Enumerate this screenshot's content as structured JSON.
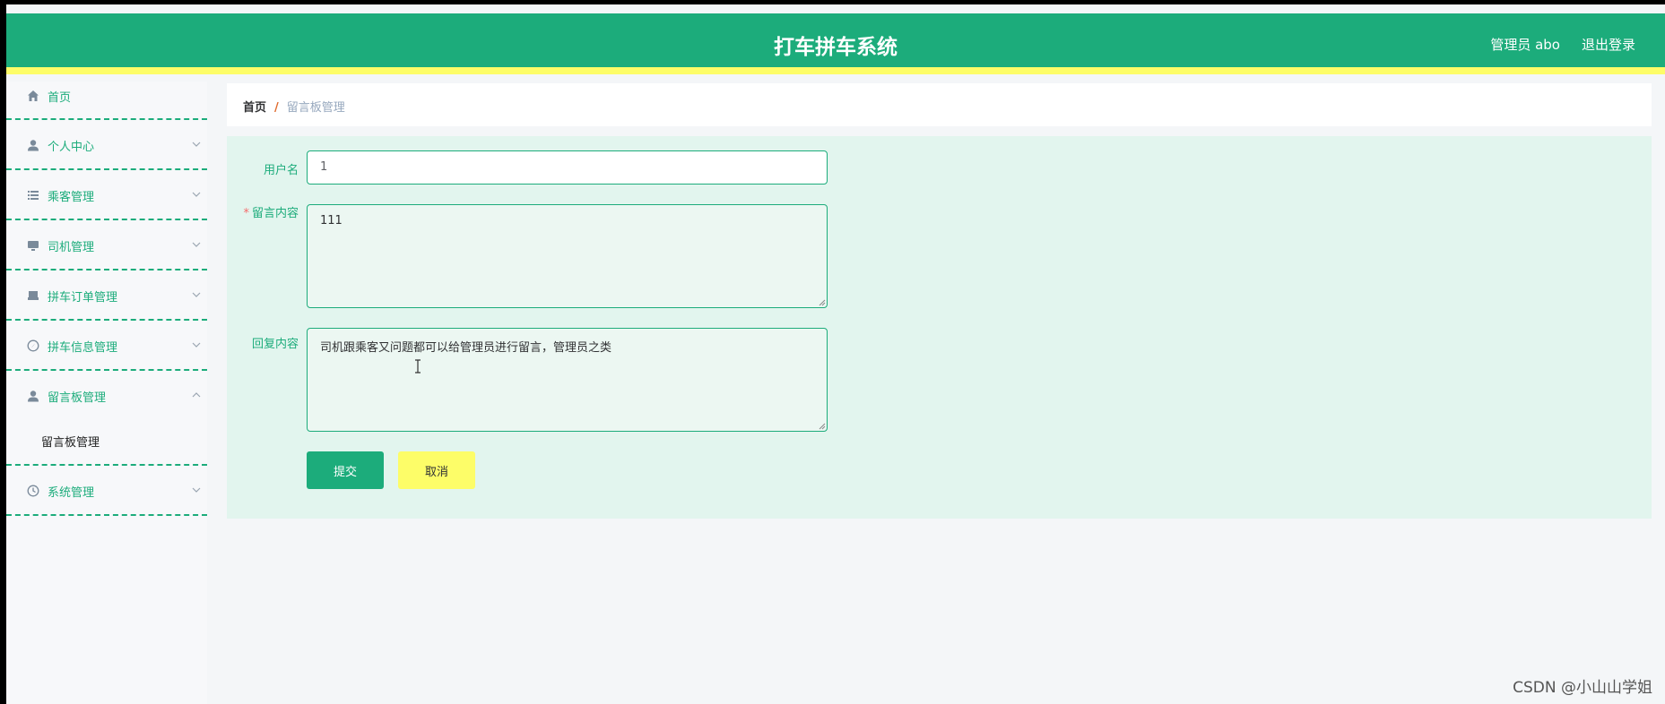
{
  "header": {
    "title": "打车拼车系统",
    "user": "管理员 abo",
    "logout": "退出登录"
  },
  "sidebar": {
    "items": [
      {
        "label": "首页",
        "icon": "home-icon"
      },
      {
        "label": "个人中心",
        "icon": "user-icon"
      },
      {
        "label": "乘客管理",
        "icon": "list-icon"
      },
      {
        "label": "司机管理",
        "icon": "monitor-icon"
      },
      {
        "label": "拼车订单管理",
        "icon": "printer-icon"
      },
      {
        "label": "拼车信息管理",
        "icon": "compass-icon"
      },
      {
        "label": "留言板管理",
        "icon": "user-icon",
        "expanded": true,
        "children": [
          "留言板管理"
        ]
      },
      {
        "label": "系统管理",
        "icon": "clock-icon"
      }
    ]
  },
  "breadcrumb": {
    "home": "首页",
    "separator": "/",
    "current": "留言板管理"
  },
  "form": {
    "username_label": "用户名",
    "username_value": "1",
    "content_required_mark": "*",
    "content_label": "留言内容",
    "content_value": "111",
    "reply_label": "回复内容",
    "reply_value": "司机跟乘客又问题都可以给管理员进行留言，管理员之类",
    "submit": "提交",
    "cancel": "取消"
  },
  "watermark": "CSDN @小山山学姐",
  "colors": {
    "primary": "#1cac7b",
    "accent_yellow": "#fdfd68",
    "panel_bg": "#e2f5ee",
    "required": "#f56c6c"
  }
}
